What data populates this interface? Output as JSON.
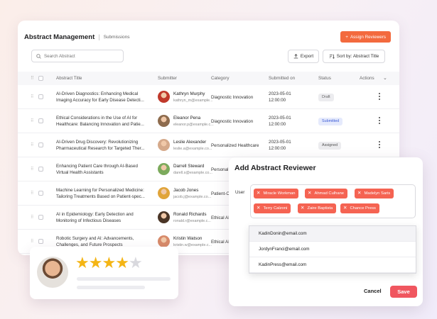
{
  "panel": {
    "title": "Abstract Management",
    "crumb": "Submissions",
    "assign_label": "Assign Reviewers",
    "search_placeholder": "Search Abstract",
    "export_label": "Export",
    "sort_label": "Sort by: Abstract Title"
  },
  "columns": [
    "Abstract Title",
    "Submitter",
    "Category",
    "Submitted on",
    "Status",
    "Actions"
  ],
  "rows": [
    {
      "title": [
        "AI-Driven Diagnostics: Enhancing Medical",
        "Imaging Accuracy for Early Disease Detecti..."
      ],
      "name": "Kathryn Murphy",
      "email": "kathryn_m@example...",
      "category": "Diagnostic Innovation",
      "date": "2023-05-01",
      "time": "12:00:00",
      "status": "Draft",
      "avatar": "#c0392b"
    },
    {
      "title": [
        "Ethical Considerations in the Use of AI for",
        "Healthcare: Balancing Innovation and Patie..."
      ],
      "name": "Eleanor Pena",
      "email": "eleanor.p@example.c...",
      "category": "Diagnostic Innovation",
      "date": "2023-05-01",
      "time": "12:00:00",
      "status": "Submitted",
      "avatar": "#8e6c4e"
    },
    {
      "title": [
        "AI-Driven Drug Discovery: Revolutionizing",
        "Pharmaceutical Research for Targeted Ther..."
      ],
      "name": "Leslie Alexander",
      "email": "leslie.a@example.co...",
      "category": "Personalized Healthcare",
      "date": "2023-05-01",
      "time": "12:00:00",
      "status": "Assigned",
      "avatar": "#d5a98a"
    },
    {
      "title": [
        "Enhancing Patient Care through AI-Based",
        "Virtual Health Assistants"
      ],
      "name": "Darrell Steward",
      "email": "darell.s@example.co...",
      "category": "Personal",
      "date": "",
      "time": "",
      "status": "",
      "avatar": "#7caa5c"
    },
    {
      "title": [
        "Machine Learning for Personalized Medicine:",
        "Tailoring Treatments Based on Patient-spec..."
      ],
      "name": "Jacob Jones",
      "email": "jacob.j@example.co...",
      "category": "Patient-C",
      "date": "",
      "time": "",
      "status": "",
      "avatar": "#e0a43a"
    },
    {
      "title": [
        "AI in Epidemiology: Early Detection and",
        "Monitoring of Infectious Diseases"
      ],
      "name": "Ronald Richards",
      "email": "ronald.r@example.c...",
      "category": "Ethical AI",
      "date": "",
      "time": "",
      "status": "",
      "avatar": "#4a3526"
    },
    {
      "title": [
        "Robotic Surgery and AI: Advancements,",
        "Challenges, and Future Prospects"
      ],
      "name": "Kristin Watson",
      "email": "kristin.w@example.c...",
      "category": "Ethical AI",
      "date": "",
      "time": "",
      "status": "",
      "avatar": "#d78a6a"
    }
  ],
  "status_colors": {
    "Draft": {
      "bg": "#ececef",
      "fg": "#666666"
    },
    "Submitted": {
      "bg": "#e5eafc",
      "fg": "#3c5bd6"
    },
    "Assigned": {
      "bg": "#ececef",
      "fg": "#555555"
    }
  },
  "dialog": {
    "title": "Add Abstract Reviewer",
    "user_label": "User",
    "chips": [
      "Miracle Workman",
      "Ahmad Culhane",
      "Madelyn Saris",
      "Terry Calzoni",
      "Zaire Baptista",
      "Chance Press"
    ],
    "options": [
      "KadinDonin@email.com",
      "JordynFranci@email.com",
      "KadinPress@email.com"
    ],
    "cancel_label": "Cancel",
    "save_label": "Save"
  },
  "review": {
    "rating": 4,
    "max": 5
  }
}
